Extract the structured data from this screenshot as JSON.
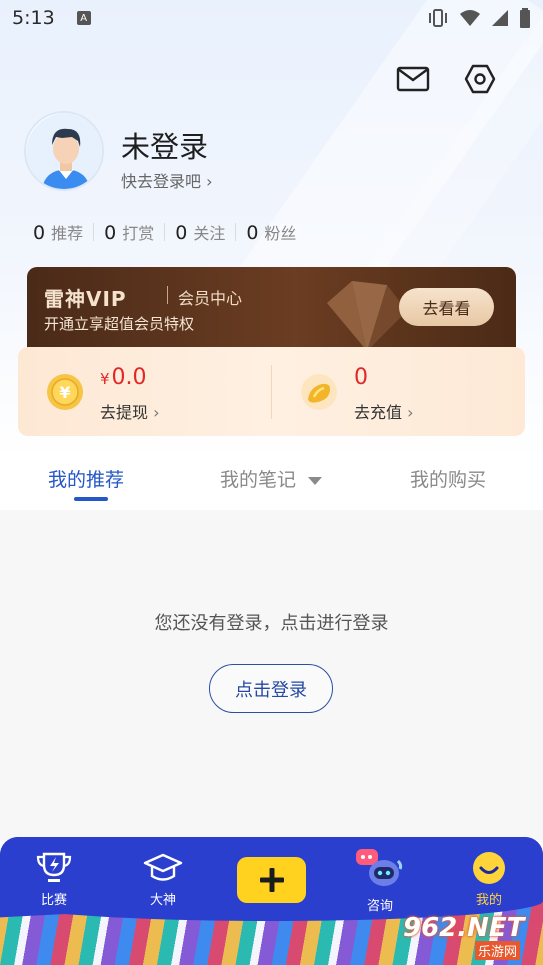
{
  "status_bar": {
    "time": "5:13",
    "notification_badge": "A"
  },
  "header": {
    "mail_icon": "mail-icon",
    "settings_icon": "hexagon-settings-icon"
  },
  "profile": {
    "username": "未登录",
    "login_hint": "快去登录吧",
    "stats": [
      {
        "value": "0",
        "label": "推荐"
      },
      {
        "value": "0",
        "label": "打赏"
      },
      {
        "value": "0",
        "label": "关注"
      },
      {
        "value": "0",
        "label": "粉丝"
      }
    ]
  },
  "vip": {
    "logo": "雷神VIP",
    "center_label": "会员中心",
    "subtitle": "开通立享超值会员特权",
    "button_label": "去看看"
  },
  "wallet": {
    "cash": {
      "currency": "¥",
      "value": "0.0",
      "action": "去提现"
    },
    "coins": {
      "value": "0",
      "action": "去充值"
    }
  },
  "tabs": [
    {
      "label": "我的推荐",
      "active": true
    },
    {
      "label": "我的笔记",
      "active": false
    },
    {
      "label": "我的购买",
      "active": false
    }
  ],
  "empty_state": {
    "message": "您还没有登录，点击进行登录",
    "button_label": "点击登录"
  },
  "bottom_nav": [
    {
      "label": "比赛",
      "icon": "trophy-lightning-icon"
    },
    {
      "label": "大神",
      "icon": "graduation-cap-icon"
    },
    {
      "label": "",
      "icon": "plus-icon"
    },
    {
      "label": "咨询",
      "icon": "robot-chat-icon"
    },
    {
      "label": "我的",
      "icon": "smiley-icon",
      "active": true
    }
  ],
  "watermark": {
    "logo": "962.NET",
    "sub": "乐游网"
  },
  "colors": {
    "accent_blue": "#2557c7",
    "nav_blue": "#2b3fcf",
    "nav_active": "#ffd43a",
    "price_red": "#e02828",
    "vip_brown": "#5a331d"
  }
}
